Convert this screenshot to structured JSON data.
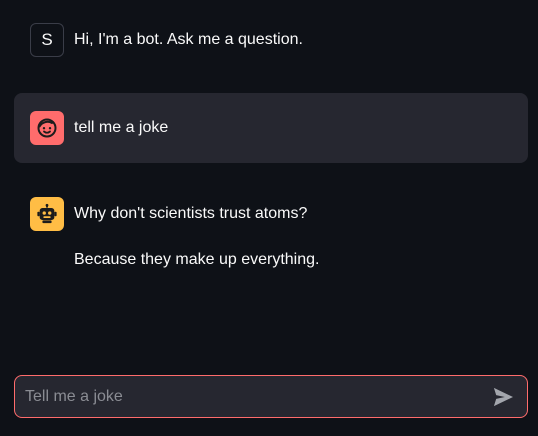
{
  "messages": [
    {
      "role": "assistant",
      "avatar": "S",
      "paragraphs": [
        "Hi, I'm a bot. Ask me a question."
      ]
    },
    {
      "role": "user",
      "avatar_icon": "smiling-face-icon",
      "paragraphs": [
        "tell me a joke"
      ]
    },
    {
      "role": "assistant",
      "avatar_icon": "robot-icon",
      "paragraphs": [
        "Why don't scientists trust atoms?",
        "Because they make up everything."
      ]
    }
  ],
  "chat_input": {
    "placeholder": "Tell me a joke",
    "value": "",
    "send_icon": "send-icon"
  },
  "colors": {
    "background": "#0e1117",
    "user_bubble": "#262730",
    "user_avatar": "#ff6c6c",
    "bot_avatar": "#ffbd45",
    "input_border": "#ff6c6c"
  }
}
